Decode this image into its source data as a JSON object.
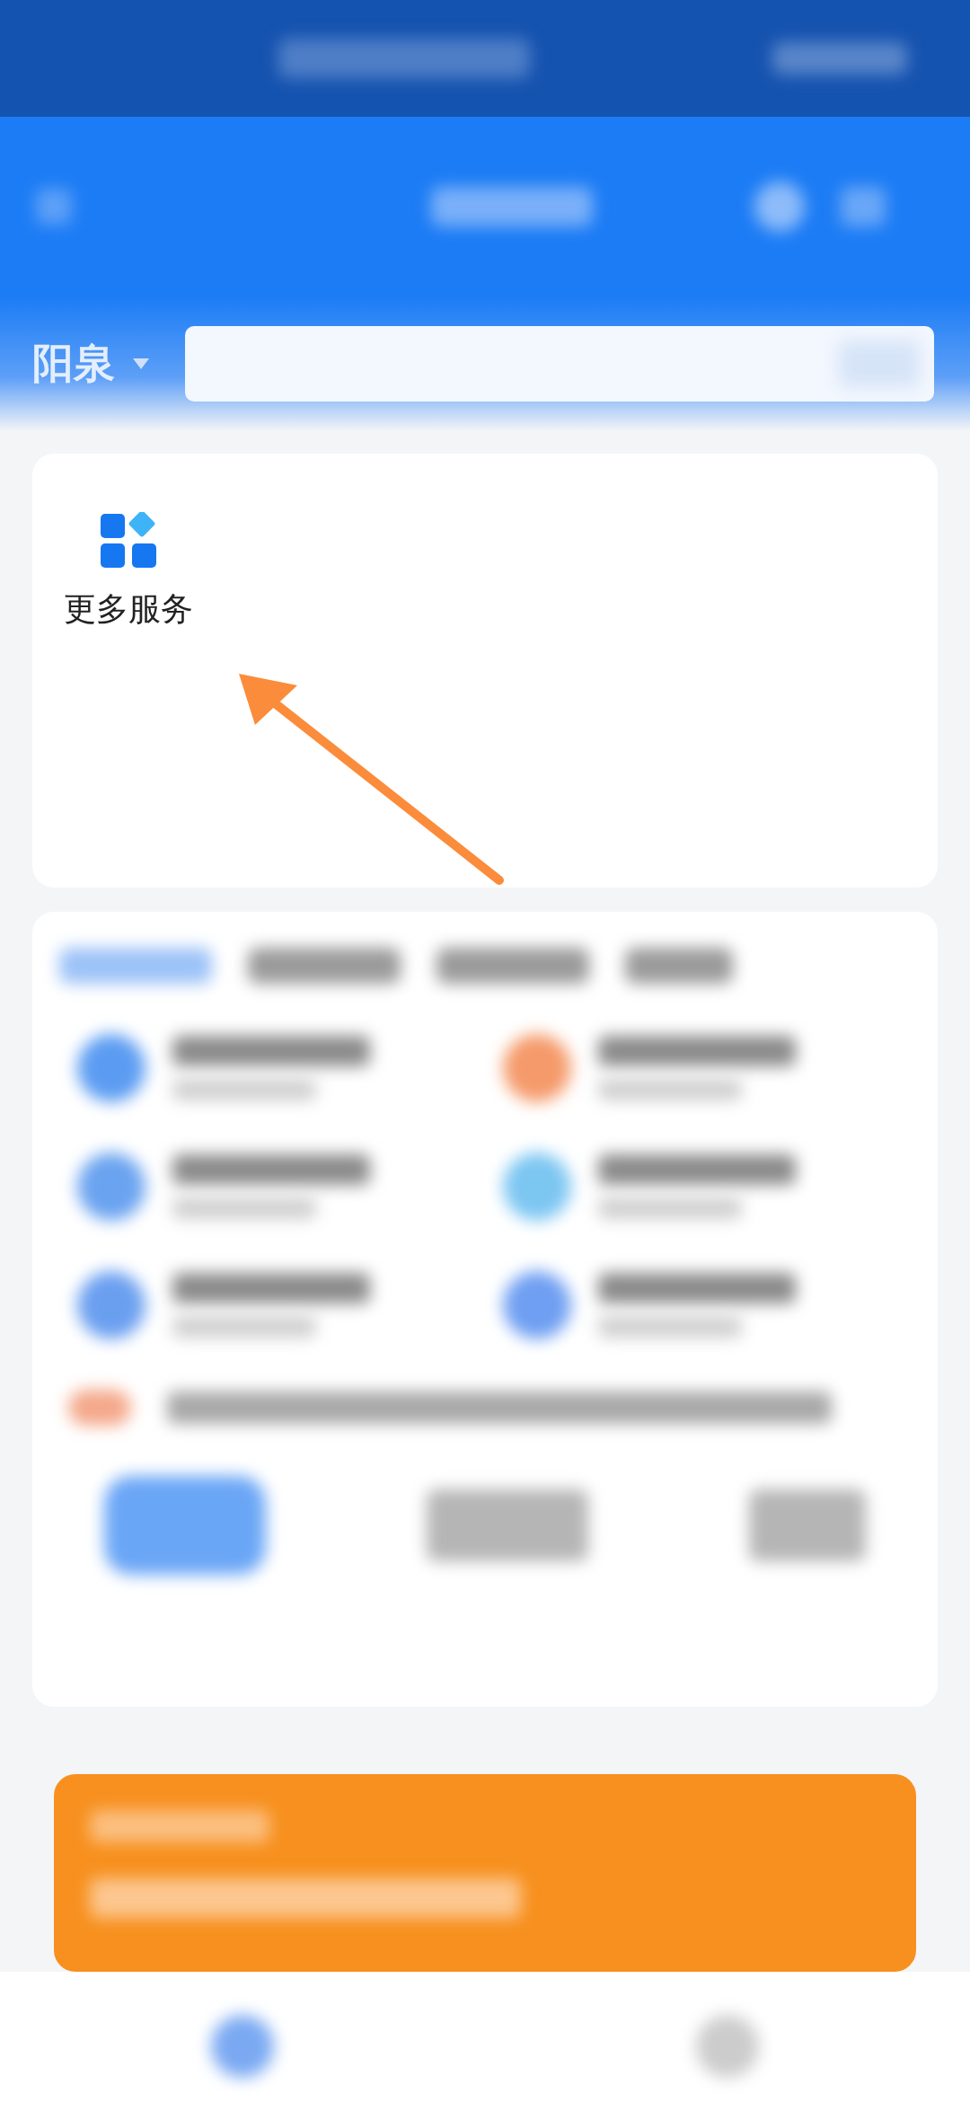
{
  "location": {
    "city": "阳泉"
  },
  "services": [
    {
      "label": "更多服务"
    }
  ],
  "annotation": {
    "kind": "arrow"
  }
}
